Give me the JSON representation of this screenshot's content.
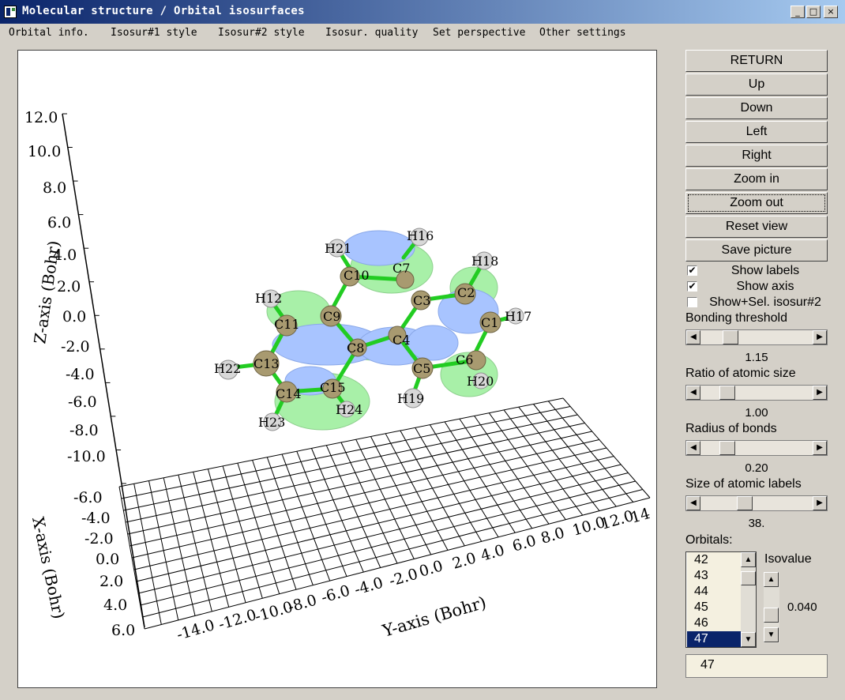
{
  "window": {
    "title": "Molecular structure / Orbital isosurfaces",
    "controls": [
      "_",
      "□",
      "×"
    ]
  },
  "menu": [
    "Orbital info.",
    "Isosur#1 style",
    "Isosur#2 style",
    "Isosur. quality",
    "Set perspective",
    "Other settings"
  ],
  "buttons": [
    "RETURN",
    "Up",
    "Down",
    "Left",
    "Right",
    "Zoom in",
    "Zoom out",
    "Reset view",
    "Save picture"
  ],
  "checkboxes": [
    {
      "label": "Show labels",
      "checked": true
    },
    {
      "label": "Show axis",
      "checked": true
    },
    {
      "label": "Show+Sel. isosur#2",
      "checked": false
    }
  ],
  "sliders": [
    {
      "label": "Bonding threshold",
      "value": "1.15"
    },
    {
      "label": "Ratio of atomic size",
      "value": "1.00"
    },
    {
      "label": "Radius of bonds",
      "value": "0.20"
    },
    {
      "label": "Size of atomic labels",
      "value": "38."
    }
  ],
  "orbitals": {
    "label": "Orbitals:",
    "items": [
      "42",
      "43",
      "44",
      "45",
      "46",
      "47"
    ],
    "selected": "47",
    "selected_value": "47"
  },
  "isovalue": {
    "label": "Isovalue",
    "value": "0.040"
  },
  "axes": {
    "z_label": "Z-axis (Bohr)",
    "x_label": "X-axis (Bohr)",
    "y_label": "Y-axis (Bohr)",
    "z_ticks": [
      "12.0",
      "10.0",
      "8.0",
      "6.0",
      "4.0",
      "2.0",
      "0.0",
      "-2.0",
      "-4.0",
      "-6.0",
      "-8.0",
      "-10.0"
    ],
    "x_ticks": [
      "-6.0",
      "-4.0",
      "-2.0",
      "0.0",
      "2.0",
      "4.0",
      "6.0"
    ],
    "y_ticks": [
      "-14.0",
      "-12.0",
      "-10.0",
      "-8.0",
      "-6.0",
      "-4.0",
      "-2.0",
      "0.0",
      "2.0",
      "4.0",
      "6.0",
      "8.0",
      "10.0",
      "12.0",
      "14"
    ]
  },
  "atoms": [
    "C1",
    "C2",
    "C3",
    "C4",
    "C5",
    "C6",
    "C7",
    "C8",
    "C9",
    "C10",
    "C11",
    "H12",
    "C13",
    "C14",
    "C15",
    "H16",
    "H17",
    "H18",
    "H19",
    "H20",
    "H21",
    "H22",
    "H23",
    "H24"
  ],
  "colors": {
    "positive_lobe": "#a8f0a8",
    "negative_lobe": "#a8c4ff",
    "bond": "#22cc22",
    "carbon": "#a89a70",
    "hydrogen": "#d8d8d8",
    "selection": "#0a246a"
  }
}
